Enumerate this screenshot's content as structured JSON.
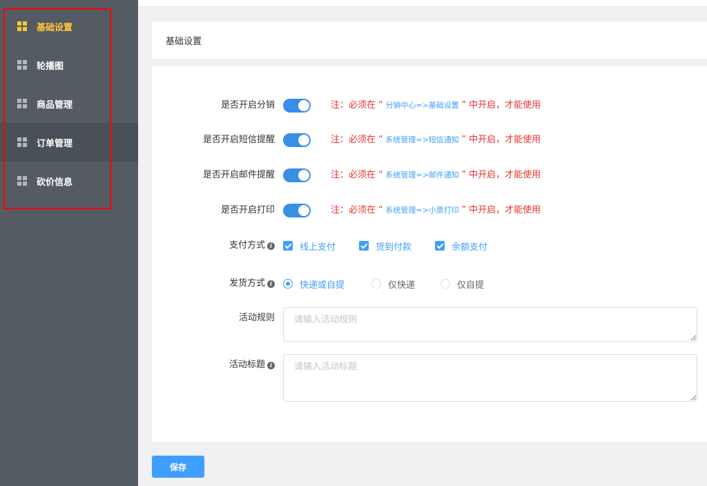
{
  "sidebar": {
    "items": [
      {
        "label": "基础设置",
        "icon": "grid-icon",
        "active": true
      },
      {
        "label": "轮播图",
        "icon": "grid-icon"
      },
      {
        "label": "商品管理",
        "icon": "grid-icon"
      },
      {
        "label": "订单管理",
        "icon": "grid-icon",
        "hovered": true
      },
      {
        "label": "砍价信息",
        "icon": "grid-icon"
      }
    ]
  },
  "header": {
    "title": "基础设置"
  },
  "form": {
    "toggles": [
      {
        "label": "是否开启分销",
        "on": true,
        "note_prefix": "注：必须在 “",
        "note_path": " 分销中心=>基础设置 ",
        "note_suffix": "” 中开启，才能使用"
      },
      {
        "label": "是否开启短信提醒",
        "on": true,
        "note_prefix": "注：必须在 “",
        "note_path": " 系统管理=>短信通知 ",
        "note_suffix": "” 中开启，才能使用"
      },
      {
        "label": "是否开启邮件提醒",
        "on": true,
        "note_prefix": "注：必须在 “",
        "note_path": " 系统管理=>邮件通知 ",
        "note_suffix": "” 中开启，才能使用"
      },
      {
        "label": "是否开启打印",
        "on": true,
        "note_prefix": "注：必须在 “",
        "note_path": " 系统管理=>小票打印 ",
        "note_suffix": "” 中开启，才能使用"
      }
    ],
    "payment": {
      "label": "支付方式",
      "options": [
        {
          "label": "线上支付",
          "checked": true
        },
        {
          "label": "货到付款",
          "checked": true
        },
        {
          "label": "余额支付",
          "checked": true
        }
      ]
    },
    "delivery": {
      "label": "发货方式",
      "options": [
        {
          "label": "快递或自提",
          "selected": true
        },
        {
          "label": "仅快递",
          "selected": false
        },
        {
          "label": "仅自提",
          "selected": false
        }
      ]
    },
    "activity_rule": {
      "label": "活动规则",
      "value": "",
      "placeholder": "请输入活动规则"
    },
    "activity_title": {
      "label": "活动标题",
      "value": "",
      "placeholder": "请输入活动标题"
    }
  },
  "save_label": "保存",
  "colors": {
    "sidebar_bg": "#545b62",
    "active_menu": "#ffc53d",
    "primary": "#409eff",
    "note_red": "#e8322f",
    "highlight_frame": "#ff0000"
  }
}
